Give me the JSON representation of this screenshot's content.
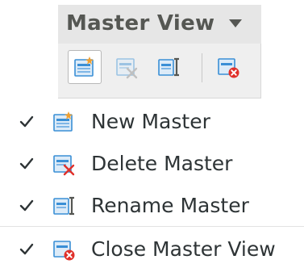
{
  "toolbar": {
    "title": "Master View",
    "dropdown_icon": "triangle-down-icon",
    "buttons": [
      {
        "name": "new-master",
        "icon": "new-master-icon",
        "active": true
      },
      {
        "name": "delete-master",
        "icon": "delete-master-icon",
        "active": false
      },
      {
        "name": "rename-master",
        "icon": "rename-master-icon",
        "active": false
      },
      {
        "name": "close-master-view",
        "icon": "close-master-view-icon",
        "active": false
      }
    ]
  },
  "menu": {
    "items": [
      {
        "label": "New Master",
        "checked": true,
        "icon": "new-master-icon"
      },
      {
        "label": "Delete Master",
        "checked": true,
        "icon": "delete-master-icon"
      },
      {
        "label": "Rename Master",
        "checked": true,
        "icon": "rename-master-icon"
      },
      {
        "label": "Close Master View",
        "checked": true,
        "icon": "close-master-view-icon"
      }
    ]
  },
  "colors": {
    "panel_bg": "#efefef",
    "title_text": "#555753",
    "menu_text": "#2e3436",
    "icon_blue": "#3a8fd6",
    "icon_red": "#e0302a",
    "icon_orange": "#f0a030"
  }
}
